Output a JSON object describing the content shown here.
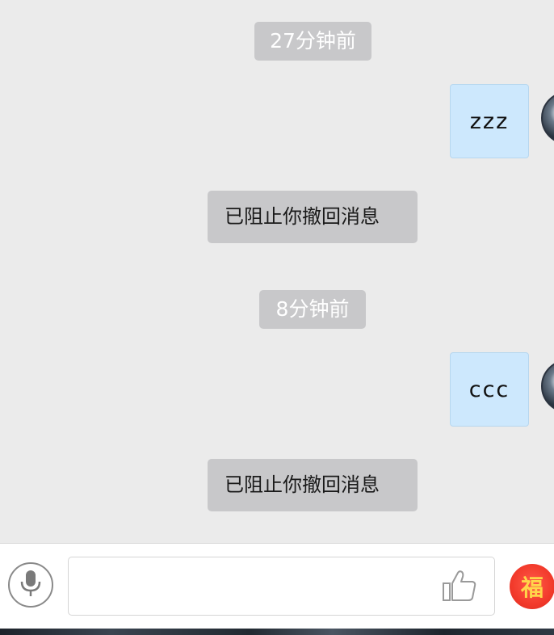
{
  "messages": {
    "timestamp_1": "27分钟前",
    "bubble_1": "zzz",
    "system_1": "已阻止你撤回消息",
    "timestamp_2": "8分钟前",
    "bubble_2": "ccc",
    "system_2": "已阻止你撤回消息"
  },
  "input_bar": {
    "voice_icon": "microphone-icon",
    "text_value": "",
    "like_icon": "thumbs-up-icon",
    "fu_label": "福"
  },
  "colors": {
    "chat_background": "#ebebeb",
    "bubble_self": "#cde8fd",
    "system_bubble": "#c8c8ca",
    "fu_red": "#f23a2b"
  }
}
